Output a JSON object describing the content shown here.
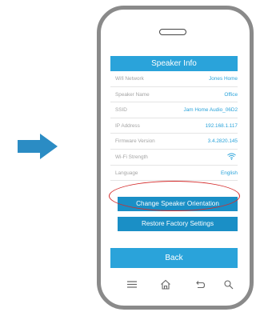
{
  "screen": {
    "title": "Speaker Info",
    "rows": [
      {
        "label": "Wifi Network",
        "value": "Jones Home"
      },
      {
        "label": "Speaker Name",
        "value": "Office"
      },
      {
        "label": "SSID",
        "value": "Jam Home Audio_06D2"
      },
      {
        "label": "IP Address",
        "value": "192.168.1.117"
      },
      {
        "label": "Firmware Version",
        "value": "3.4.2820.145"
      },
      {
        "label": "Wi-Fi Strength",
        "icon": "wifi-signal-icon"
      },
      {
        "label": "Language",
        "value": "English"
      }
    ],
    "buttons": {
      "change_orientation": "Change Speaker Orientation",
      "restore_factory": "Restore Factory Settings"
    },
    "back_label": "Back"
  },
  "navbar": {
    "icons": [
      "menu-icon",
      "home-icon",
      "back-arrow-icon",
      "search-icon"
    ]
  },
  "colors": {
    "accent": "#2aa3da",
    "button": "#1a8fc6",
    "label_gray": "#a4a4a4",
    "highlight_oval": "#d42b2b",
    "arrow": "#2b8cc4",
    "phone_frame": "#8a8a8a"
  },
  "decorations": {
    "pointer": "right-arrow-icon",
    "highlight": "Language row circled in red"
  }
}
